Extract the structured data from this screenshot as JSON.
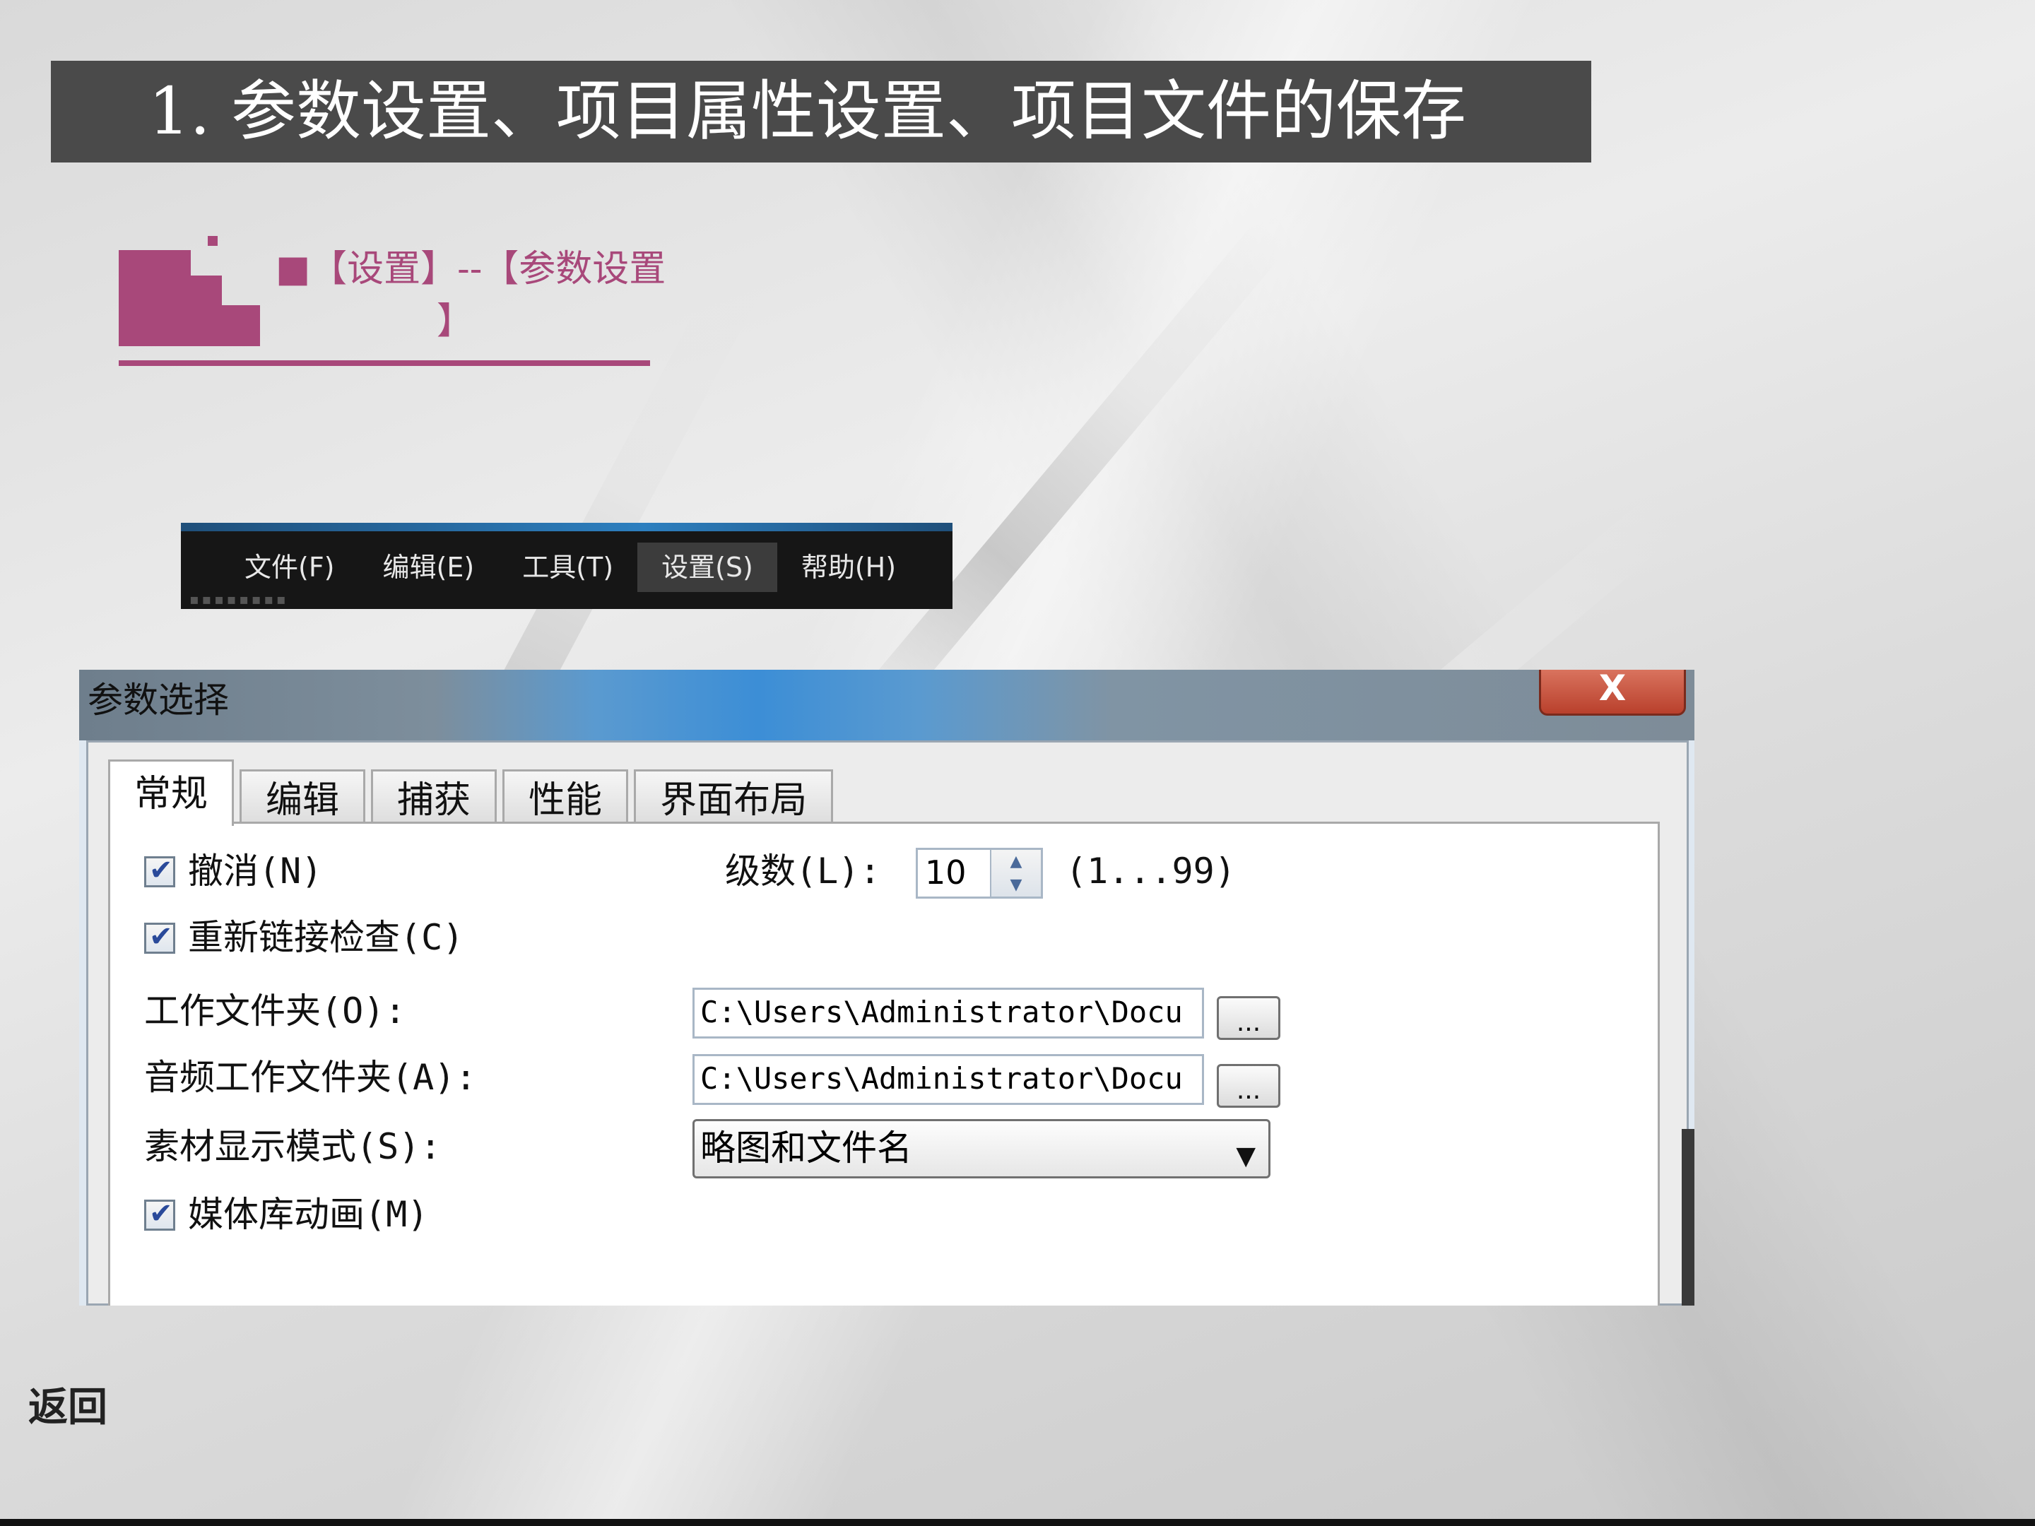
{
  "slide": {
    "title": "1. 参数设置、项目属性设置、项目文件的保存",
    "breadcrumb_line1": "■【设置】--【参数设置",
    "breadcrumb_line2": "】",
    "back_link": "返回"
  },
  "menubar": {
    "items": [
      "文件(F)",
      "编辑(E)",
      "工具(T)",
      "设置(S)",
      "帮助(H)"
    ],
    "active": "设置(S)"
  },
  "dialog": {
    "title": "参数选择",
    "close_label": "X",
    "tabs": [
      "常规",
      "编辑",
      "捕获",
      "性能",
      "界面布局"
    ],
    "active_tab": "常规",
    "undo_label": "撤消(N)",
    "undo_checked": true,
    "levels_label": "级数(L):",
    "levels_value": "10",
    "levels_range": "(1...99)",
    "relink_label": "重新链接检查(C)",
    "relink_checked": true,
    "work_folder_label": "工作文件夹(O):",
    "work_folder_value": "C:\\Users\\Administrator\\Docu",
    "audio_folder_label": "音频工作文件夹(A):",
    "audio_folder_value": "C:\\Users\\Administrator\\Docu",
    "browse_label": "...",
    "display_mode_label": "素材显示模式(S):",
    "display_mode_value": "略图和文件名",
    "media_anim_label": "媒体库动画(M)",
    "media_anim_checked": true
  },
  "colors": {
    "title_bar": "#4a4a4a",
    "accent": "#a8487a",
    "menu_bg": "#161616",
    "dialog_title_blue": "#3c8ed6"
  }
}
